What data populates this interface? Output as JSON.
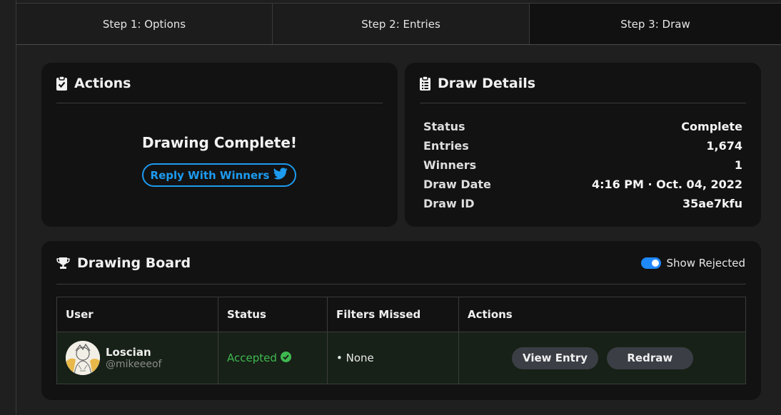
{
  "tabs": [
    {
      "label": "Step 1: Options"
    },
    {
      "label": "Step 2: Entries"
    },
    {
      "label": "Step 3: Draw",
      "active": true
    }
  ],
  "actions": {
    "title": "Actions",
    "icon": "clipboard-check-icon",
    "message": "Drawing Complete!",
    "reply_button": "Reply With Winners",
    "reply_icon": "twitter-icon"
  },
  "draw_details": {
    "title": "Draw Details",
    "icon": "clipboard-list-icon",
    "rows": [
      {
        "label": "Status",
        "value": "Complete"
      },
      {
        "label": "Entries",
        "value": "1,674"
      },
      {
        "label": "Winners",
        "value": "1"
      },
      {
        "label": "Draw Date",
        "value": "4:16 PM · Oct. 04, 2022"
      },
      {
        "label": "Draw ID",
        "value": "35ae7kfu"
      }
    ]
  },
  "board": {
    "title": "Drawing Board",
    "icon": "trophy-icon",
    "toggle_label": "Show Rejected",
    "toggle_on": true,
    "columns": [
      "User",
      "Status",
      "Filters Missed",
      "Actions"
    ],
    "rows": [
      {
        "name": "Loscian",
        "handle": "@mikeeeof",
        "status": "Accepted",
        "filters_missed": "• None",
        "view_button": "View Entry",
        "redraw_button": "Redraw"
      }
    ]
  },
  "colors": {
    "accent_blue": "#1d9bf0",
    "accepted_green": "#3fb950",
    "toggle_blue": "#1e88ff"
  }
}
